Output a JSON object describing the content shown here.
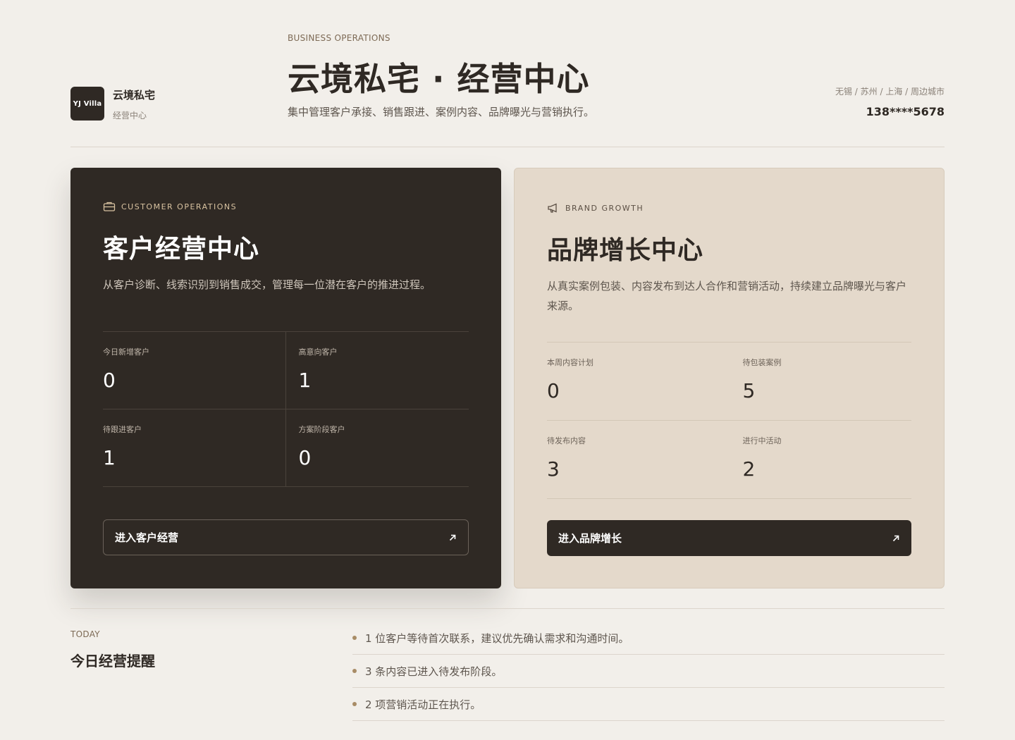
{
  "brand": {
    "logo_text": "YJ Villa",
    "name": "云境私宅",
    "sub": "经营中心"
  },
  "header": {
    "eyebrow": "BUSINESS OPERATIONS",
    "title": "云境私宅 · 经营中心",
    "subtitle": "集中管理客户承接、销售跟进、案例内容、品牌曝光与营销执行。",
    "cities": "无锡 / 苏州 / 上海 / 周边城市",
    "phone": "138****5678"
  },
  "customer_card": {
    "tag": "CUSTOMER OPERATIONS",
    "icon": "briefcase-icon",
    "title": "客户经营中心",
    "desc": "从客户诊断、线索识别到销售成交，管理每一位潜在客户的推进过程。",
    "stats": [
      {
        "label": "今日新增客户",
        "value": "0"
      },
      {
        "label": "高意向客户",
        "value": "1"
      },
      {
        "label": "待跟进客户",
        "value": "1"
      },
      {
        "label": "方案阶段客户",
        "value": "0"
      }
    ],
    "button": "进入客户经营"
  },
  "brand_card": {
    "tag": "BRAND GROWTH",
    "icon": "megaphone-icon",
    "title": "品牌增长中心",
    "desc": "从真实案例包装、内容发布到达人合作和营销活动，持续建立品牌曝光与客户来源。",
    "stats": [
      {
        "label": "本周内容计划",
        "value": "0"
      },
      {
        "label": "待包装案例",
        "value": "5"
      },
      {
        "label": "待发布内容",
        "value": "3"
      },
      {
        "label": "进行中活动",
        "value": "2"
      }
    ],
    "button": "进入品牌增长"
  },
  "today": {
    "eyebrow": "TODAY",
    "title": "今日经营提醒",
    "items": [
      "1 位客户等待首次联系，建议优先确认需求和沟通时间。",
      "3 条内容已进入待发布阶段。",
      "2 项营销活动正在执行。"
    ]
  },
  "colors": {
    "background": "#f2efea",
    "dark": "#2f2924",
    "light_card": "#e4d9cb",
    "accent": "#a88c66"
  }
}
